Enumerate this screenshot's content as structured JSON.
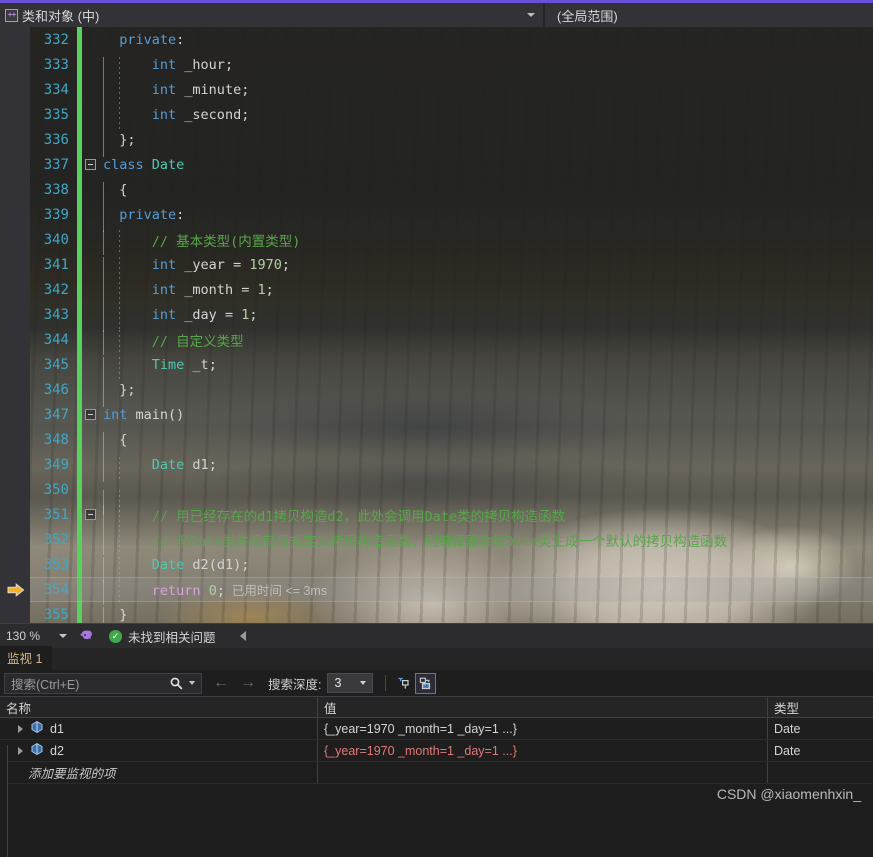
{
  "window": {
    "accent_color": "#6b4fd8"
  },
  "nav_bar": {
    "class_icon_name": "cpp-class-icon",
    "class_icon_glyph": "++",
    "scope_member": "类和对象 (中)",
    "scope_global": "(全局范围)"
  },
  "editor": {
    "first_line_number": 332,
    "lines": [
      {
        "num": "332",
        "indent_guides": [],
        "fold": false,
        "tokens": [
          {
            "t": "private",
            "c": "kw"
          },
          {
            "t": ":",
            "c": "pun"
          }
        ],
        "lead": "  "
      },
      {
        "num": "333",
        "fold": false,
        "tokens": [
          {
            "t": "int",
            "c": "kw"
          },
          {
            "t": " _hour",
            "c": "plain"
          },
          {
            "t": ";",
            "c": "pun"
          }
        ],
        "lead": "      "
      },
      {
        "num": "334",
        "fold": false,
        "tokens": [
          {
            "t": "int",
            "c": "kw"
          },
          {
            "t": " _minute",
            "c": "plain"
          },
          {
            "t": ";",
            "c": "pun"
          }
        ],
        "lead": "      "
      },
      {
        "num": "335",
        "fold": false,
        "tokens": [
          {
            "t": "int",
            "c": "kw"
          },
          {
            "t": " _second",
            "c": "plain"
          },
          {
            "t": ";",
            "c": "pun"
          }
        ],
        "lead": "      "
      },
      {
        "num": "336",
        "fold": false,
        "tokens": [
          {
            "t": "};",
            "c": "pun"
          }
        ],
        "lead": "  "
      },
      {
        "num": "337",
        "fold": true,
        "tokens": [
          {
            "t": "class",
            "c": "kw"
          },
          {
            "t": " ",
            "c": "plain"
          },
          {
            "t": "Date",
            "c": "typ"
          }
        ],
        "lead": ""
      },
      {
        "num": "338",
        "fold": false,
        "tokens": [
          {
            "t": "{",
            "c": "pun"
          }
        ],
        "lead": "  "
      },
      {
        "num": "339",
        "fold": false,
        "tokens": [
          {
            "t": "private",
            "c": "kw"
          },
          {
            "t": ":",
            "c": "pun"
          }
        ],
        "lead": "  "
      },
      {
        "num": "340",
        "fold": false,
        "tokens": [
          {
            "t": "// 基本类型(内置类型)",
            "c": "cmt"
          }
        ],
        "lead": "      "
      },
      {
        "num": "341",
        "fold": false,
        "tokens": [
          {
            "t": "int",
            "c": "kw"
          },
          {
            "t": " _year ",
            "c": "plain"
          },
          {
            "t": "=",
            "c": "pun"
          },
          {
            "t": " ",
            "c": "plain"
          },
          {
            "t": "1970",
            "c": "num"
          },
          {
            "t": ";",
            "c": "pun"
          }
        ],
        "lead": "      "
      },
      {
        "num": "342",
        "fold": false,
        "tokens": [
          {
            "t": "int",
            "c": "kw"
          },
          {
            "t": " _month ",
            "c": "plain"
          },
          {
            "t": "=",
            "c": "pun"
          },
          {
            "t": " ",
            "c": "plain"
          },
          {
            "t": "1",
            "c": "num"
          },
          {
            "t": ";",
            "c": "pun"
          }
        ],
        "lead": "      "
      },
      {
        "num": "343",
        "fold": false,
        "tokens": [
          {
            "t": "int",
            "c": "kw"
          },
          {
            "t": " _day ",
            "c": "plain"
          },
          {
            "t": "=",
            "c": "pun"
          },
          {
            "t": " ",
            "c": "plain"
          },
          {
            "t": "1",
            "c": "num"
          },
          {
            "t": ";",
            "c": "pun"
          }
        ],
        "lead": "      "
      },
      {
        "num": "344",
        "fold": false,
        "tokens": [
          {
            "t": "// 自定义类型",
            "c": "cmt"
          }
        ],
        "lead": "      "
      },
      {
        "num": "345",
        "fold": false,
        "tokens": [
          {
            "t": "Time",
            "c": "typ"
          },
          {
            "t": " _t",
            "c": "plain"
          },
          {
            "t": ";",
            "c": "pun"
          }
        ],
        "lead": "      "
      },
      {
        "num": "346",
        "fold": false,
        "tokens": [
          {
            "t": "};",
            "c": "pun"
          }
        ],
        "lead": "  "
      },
      {
        "num": "347",
        "fold": true,
        "tokens": [
          {
            "t": "int",
            "c": "kw"
          },
          {
            "t": " ",
            "c": "plain"
          },
          {
            "t": "main",
            "c": "plain"
          },
          {
            "t": "()",
            "c": "pun"
          }
        ],
        "lead": ""
      },
      {
        "num": "348",
        "fold": false,
        "tokens": [
          {
            "t": "{",
            "c": "pun"
          }
        ],
        "lead": "  "
      },
      {
        "num": "349",
        "fold": false,
        "tokens": [
          {
            "t": "Date",
            "c": "typ"
          },
          {
            "t": " d1",
            "c": "plain"
          },
          {
            "t": ";",
            "c": "pun"
          }
        ],
        "lead": "      "
      },
      {
        "num": "350",
        "fold": false,
        "tokens": [],
        "lead": ""
      },
      {
        "num": "351",
        "fold": true,
        "tokens": [
          {
            "t": "// 用已经存在的d1拷贝构造d2，此处会调用Date类的拷贝构造函数",
            "c": "cmt"
          }
        ],
        "lead": "      "
      },
      {
        "num": "352",
        "fold": false,
        "tokens": [
          {
            "t": "// 但Date类并没有显式定义拷贝构造函数，则编译器会给Date类生成一个默认的拷贝构造函数",
            "c": "cmt"
          }
        ],
        "lead": "      "
      },
      {
        "num": "353",
        "fold": false,
        "tokens": [
          {
            "t": "Date",
            "c": "typ"
          },
          {
            "t": " d2",
            "c": "plain"
          },
          {
            "t": "(d1);",
            "c": "pun"
          }
        ],
        "lead": "      "
      },
      {
        "num": "354",
        "fold": false,
        "current": true,
        "tokens": [
          {
            "t": "return",
            "c": "ctl"
          },
          {
            "t": " ",
            "c": "plain"
          },
          {
            "t": "0",
            "c": "num"
          },
          {
            "t": ";",
            "c": "pun"
          }
        ],
        "lead": "      ",
        "inline_hint": "已用时间 <= 3ms"
      },
      {
        "num": "355",
        "fold": false,
        "tokens": [
          {
            "t": "}",
            "c": "pun"
          }
        ],
        "lead": "  "
      }
    ],
    "current_line_marker_name": "execution-pointer-arrow",
    "current_line": "354"
  },
  "editor_status": {
    "zoom_level": "130 %",
    "brain_icon_name": "intellicode-icon",
    "health_icon_name": "success-check-icon",
    "message": "未找到相关问题",
    "collapse_icon_name": "collapse-left-icon"
  },
  "watch_panel": {
    "tab_label": "监视 1",
    "search_placeholder": "搜索(Ctrl+E)",
    "search_value": "",
    "search_icon_name": "search-icon",
    "prev_icon_name": "arrow-left-icon",
    "next_icon_name": "arrow-right-icon",
    "depth_label": "搜索深度:",
    "depth_value": "3",
    "toolbar_buttons": [
      {
        "name": "pin-to-source-button",
        "selected": false
      },
      {
        "name": "show-raw-values-button",
        "selected": true
      }
    ],
    "columns": [
      "名称",
      "值",
      "类型"
    ],
    "rows": [
      {
        "name": "d1",
        "value": "{_year=1970 _month=1 _day=1 ...}",
        "type": "Date",
        "changed": false,
        "expandable": true,
        "icon": "object-field-icon"
      },
      {
        "name": "d2",
        "value": "{_year=1970 _month=1 _day=1 ...}",
        "type": "Date",
        "changed": true,
        "expandable": true,
        "icon": "object-field-icon"
      }
    ],
    "add_item_placeholder": "添加要监视的项"
  },
  "watermark": "CSDN @xiaomenhxin_"
}
